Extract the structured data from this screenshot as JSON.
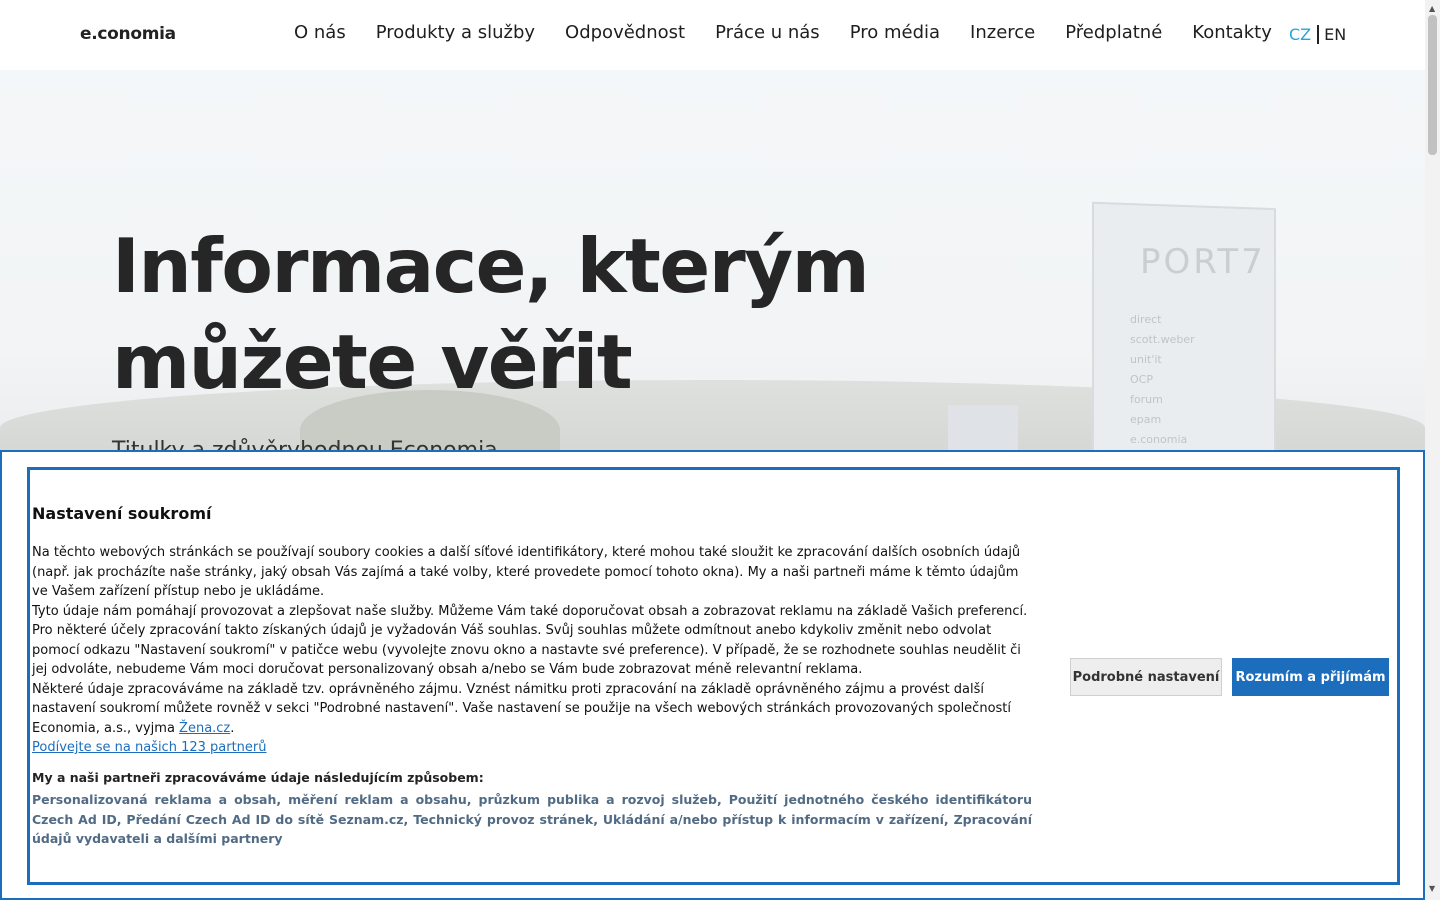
{
  "header": {
    "logo": "e.conomia",
    "nav": [
      "O nás",
      "Produkty a služby",
      "Odpovědnost",
      "Práce u nás",
      "Pro média",
      "Inzerce",
      "Předplatné",
      "Kontakty"
    ],
    "lang_cz": "CZ",
    "lang_en": "EN"
  },
  "hero": {
    "title_line1": "Informace, kterým",
    "title_line2": "můžete věřit",
    "subtitle": "Titulky a zdůvěryhodnou Economia ... ",
    "totem_title": "PORT7",
    "totem_logos": [
      "direct",
      "scott.weber",
      "unit'it",
      "OCP",
      "forum",
      "epam",
      "e.conomia"
    ]
  },
  "consent": {
    "title": "Nastavení soukromí",
    "p1": "Na těchto webových stránkách se používají soubory cookies a další síťové identifikátory, které mohou také sloužit ke zpracování dalších osobních údajů (např. jak procházíte naše stránky, jaký obsah Vás zajímá a také volby, které provedete pomocí tohoto okna). My a naši partneři máme k těmto údajům ve Vašem zařízení přístup nebo je ukládáme.",
    "p2": "Tyto údaje nám pomáhají provozovat a zlepšovat naše služby. Můžeme Vám také doporučovat obsah a zobrazovat reklamu na základě Vašich preferencí. Pro některé účely zpracování takto získaných údajů je vyžadován Váš souhlas. Svůj souhlas můžete odmítnout anebo kdykoliv změnit nebo odvolat pomocí odkazu \"Nastavení soukromí\" v patičce webu (vyvolejte znovu okno a nastavte své preference). V případě, že se rozhodnete souhlas neudělit či jej odvoláte, nebudeme Vám moci doručovat personalizovaný obsah a/nebo se Vám bude zobrazovat méně relevantní reklama.",
    "p3_pre": "Některé údaje zpracováváme na základě tzv. oprávněného zájmu. Vznést námitku proti zpracování na základě oprávněného zájmu a provést další nastavení soukromí můžete rovněž v sekci \"Podrobné nastavení\". Vaše nastavení se použije na všech webových stránkách provozovaných společností Economia, a.s., vyjma ",
    "p3_link": "Žena.cz",
    "p3_post": ".",
    "partners_link": "Podívejte se na našich 123 partnerů",
    "purposes_head": "My a naši partneři zpracováváme údaje následujícím způsobem:",
    "purposes": "Personalizovaná reklama a obsah, měření reklam a obsahu, průzkum publika a rozvoj služeb, Použití jednotného českého identifikátoru Czech Ad ID, Předání Czech Ad ID do sítě Seznam.cz, Technický provoz stránek, Ukládání a/nebo přístup k informacím v zařízení, Zpracování údajů vydavateli a dalšími partnery",
    "btn_detail": "Podrobné nastavení",
    "btn_accept": "Rozumím a přijímám"
  },
  "colors": {
    "accent": "#1c6ebd",
    "lang_active": "#2aa3d8",
    "purposes_text": "#516b85"
  }
}
